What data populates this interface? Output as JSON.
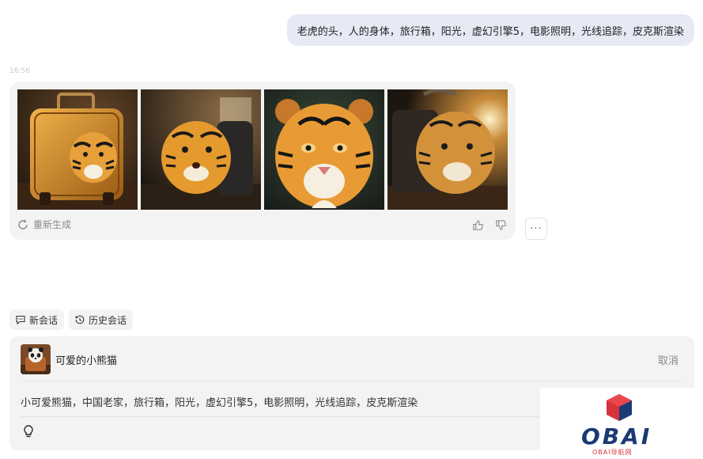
{
  "user_message": "老虎的头，人的身体，旅行箱，阳光，虚幻引擎5，电影照明，光线追踪，皮克斯渲染",
  "timestamp": "16:56",
  "generated_images": [
    {
      "icon": "tiger-suitcase-image-1"
    },
    {
      "icon": "tiger-suitcase-image-2"
    },
    {
      "icon": "tiger-portrait-image-3"
    },
    {
      "icon": "tiger-suitcase-image-4"
    }
  ],
  "actions": {
    "regenerate_label": "重新生成",
    "more_label": "···"
  },
  "session_buttons": {
    "new_chat_label": "新会话",
    "history_label": "历史会话"
  },
  "composer": {
    "role_name": "可爱的小熊猫",
    "cancel_label": "取消",
    "prompt_text": "小可爱熊猫，中国老家，旅行箱，阳光，虚幻引擎5，电影照明，光线追踪，皮克斯渲染"
  },
  "watermark": {
    "logo_text": "OBAI",
    "logo_sub": "OBAI导航网"
  },
  "colors": {
    "user_bubble": "#e7e9f5",
    "card_bg": "#f3f3f3",
    "logo_blue": "#1a3a73",
    "logo_red": "#d8333a"
  }
}
